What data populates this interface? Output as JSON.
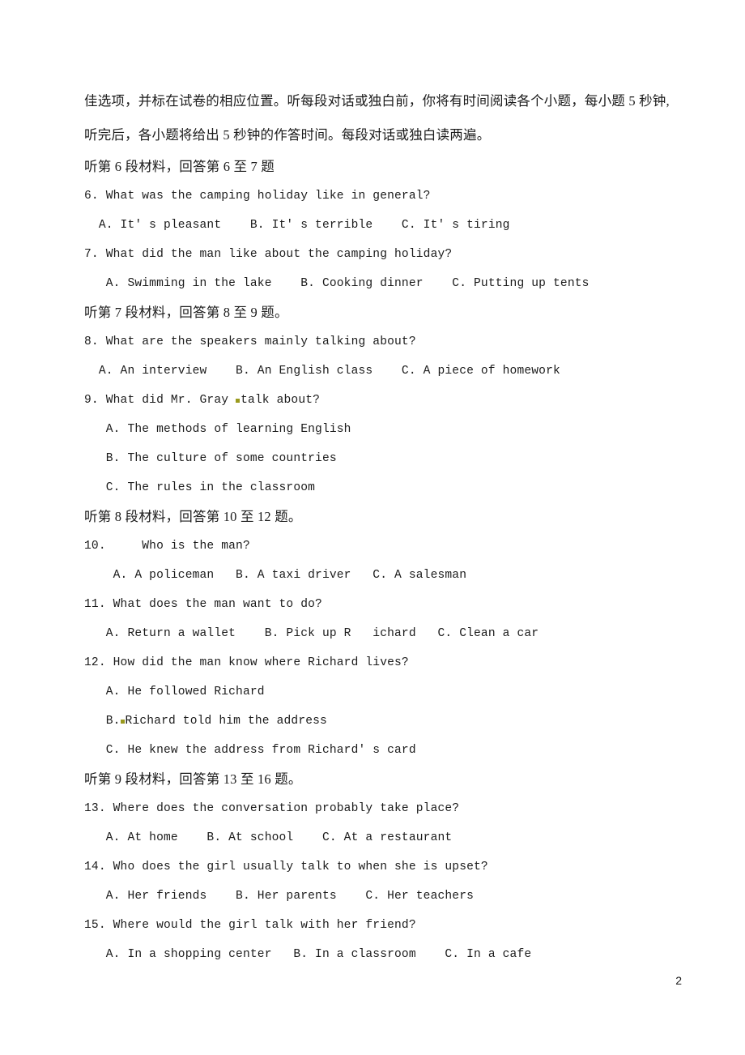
{
  "document": {
    "page_number": "2",
    "stray_mark_color": "#9a9a1e",
    "text_color": "#1b1b1b",
    "background_color": "#ffffff"
  },
  "intro": {
    "line1": "佳选项，并标在试卷的相应位置。听每段对话或独白前，你将有时间阅读各个小题，每小题 5 秒钟,",
    "line2": "听完后，各小题将给出 5 秒钟的作答时间。每段对话或独白读两遍。"
  },
  "sections": [
    {
      "heading": "听第 6 段材料，回答第 6 至 7 题",
      "questions": [
        {
          "number": "6.",
          "stem": "6. What was the camping holiday like in general?",
          "options_line": "  A. It' s pleasant    B. It' s terrible    C. It' s tiring"
        },
        {
          "number": "7.",
          "stem": "7. What did the man like about the camping holiday?",
          "options_line": "   A. Swimming in the lake    B. Cooking dinner    C. Putting up tents"
        }
      ]
    },
    {
      "heading": "听第 7 段材料，回答第 8 至 9 题。",
      "questions": [
        {
          "number": "8.",
          "stem": "8. What are the speakers mainly talking about?",
          "options_line": "  A. An interview    B. An English class    C. A piece of homework"
        },
        {
          "number": "9.",
          "stem_pre": "9. What did Mr. Gray ",
          "stem_post": "talk about?",
          "has_stray_mark": true,
          "options": [
            "   A. The methods of learning English",
            "   B. The culture of some countries",
            "   C. The rules in the classroom"
          ]
        }
      ]
    },
    {
      "heading": "听第 8 段材料，回答第 10 至 12 题。",
      "questions": [
        {
          "number": "10.",
          "stem": "10.     Who is the man?",
          "options_line": "    A. A policeman   B. A taxi driver   C. A salesman"
        },
        {
          "number": "11.",
          "stem": "11. What does the man want to do?",
          "options_line": "   A. Return a wallet    B. Pick up R   ichard   C. Clean a car"
        },
        {
          "number": "12.",
          "stem": "12. How did the man know where Richard lives?",
          "options": [
            "   A. He followed Richard",
            "   C. He knew the address from Richard' s card"
          ],
          "option_b_pre": "   B.",
          "option_b_post": "Richard told him the address",
          "option_b_has_stray_mark": true
        }
      ]
    },
    {
      "heading": "听第 9 段材料，回答第 13 至 16 题。",
      "questions": [
        {
          "number": "13.",
          "stem": "13. Where does the conversation probably take place?",
          "options_line": "   A. At home    B. At school    C. At a restaurant"
        },
        {
          "number": "14.",
          "stem": "14. Who does the girl usually talk to when she is upset?",
          "options_line": "   A. Her friends    B. Her parents    C. Her teachers"
        },
        {
          "number": "15.",
          "stem": "15. Where would the girl talk with her friend?",
          "options_line": "   A. In a shopping center   B. In a classroom    C. In a cafe"
        }
      ]
    }
  ]
}
